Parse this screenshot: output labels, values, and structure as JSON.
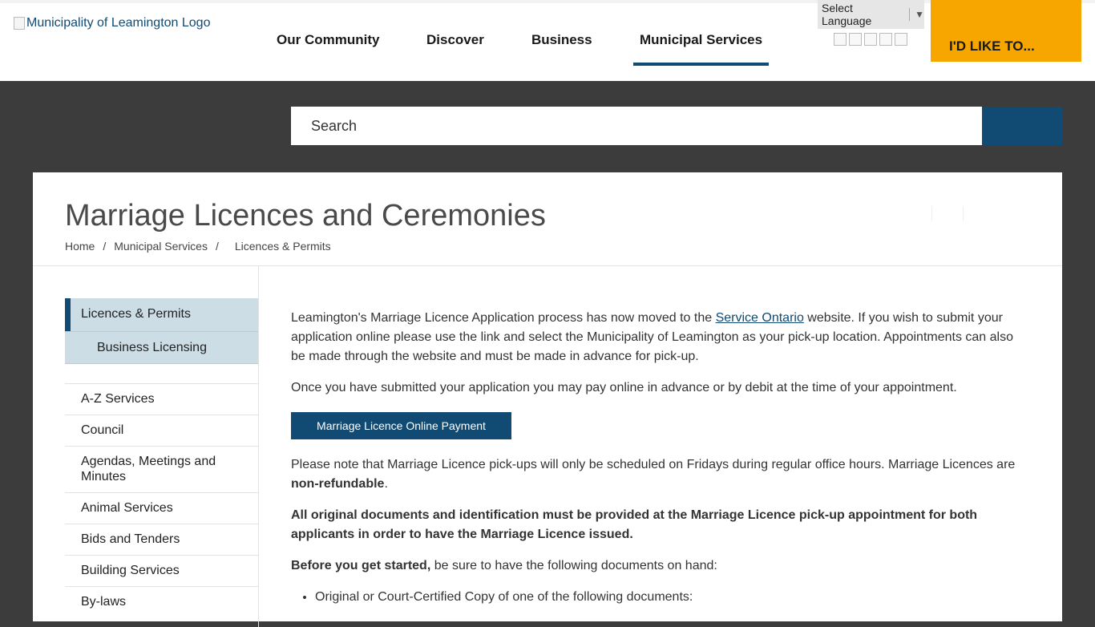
{
  "header": {
    "logo_alt": "Municipality of Leamington Logo",
    "nav": [
      "Our Community",
      "Discover",
      "Business",
      "Municipal Services"
    ],
    "active_nav": "Municipal Services",
    "language_label": "Select Language",
    "cta_label": "I'D LIKE TO..."
  },
  "search": {
    "placeholder": "Search"
  },
  "page": {
    "title": "Marriage Licences and Ceremonies",
    "breadcrumb": [
      "Home",
      "Municipal Services",
      "Licences & Permits"
    ]
  },
  "sidebar": {
    "current": "Licences & Permits",
    "child": "Business Licensing",
    "items": [
      "A-Z Services",
      "Council",
      "Agendas, Meetings and Minutes",
      "Animal Services",
      "Bids and Tenders",
      "Building Services",
      "By-laws"
    ]
  },
  "content": {
    "p1_before": "Leamington's Marriage Licence Application process has now moved to the ",
    "p1_link": "Service Ontario",
    "p1_after": " website. If you wish to submit your application online please use the link and select the Municipality of Leamington as your pick-up location. Appointments can also be made through the website and must be made in advance for pick-up.",
    "p2": "Once you have submitted your application you may pay online in advance or by debit at the time of your appointment.",
    "pay_button": "Marriage Licence Online Payment",
    "p3_before": "Please note that Marriage Licence pick-ups will only be scheduled on Fridays during regular office hours. Marriage Licences are ",
    "p3_bold": "non-refundable",
    "p3_after": ".",
    "p4": "All original documents and identification must be provided at the Marriage Licence pick-up appointment for both applicants in order to have the Marriage Licence issued.",
    "p5_bold": "Before you get started,",
    "p5_after": " be sure to have the following documents on hand:",
    "list": [
      "Original or Court-Certified Copy of one of the following documents:"
    ]
  },
  "colors": {
    "brand": "#114a72",
    "accent": "#f7a600",
    "band": "#3c3c3c"
  }
}
